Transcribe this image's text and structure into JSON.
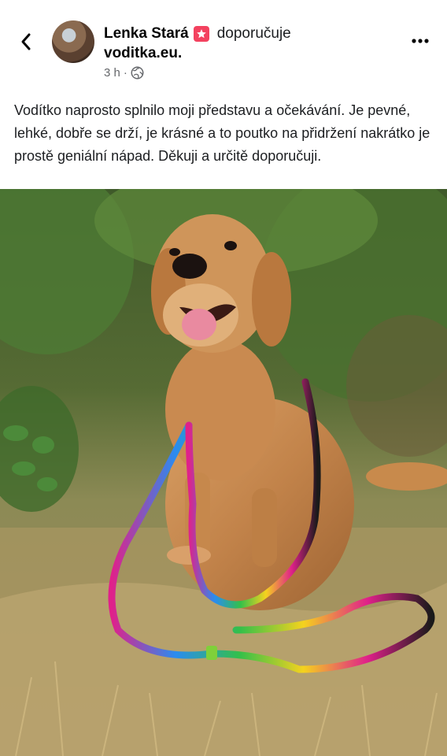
{
  "post": {
    "author": "Lenka Stará",
    "verb": "doporučuje",
    "page": "voditka.eu.",
    "time": "3 h",
    "separator": "·",
    "text": "Vodítko naprosto splnilo moji představu a očekávání. Je pevné, lehké, dobře se drží, je krásné a to poutko na přidržení nakrátko je prostě geniální nápad. Děkuji a určitě doporučuji."
  },
  "icons": {
    "back": "chevron-left-icon",
    "badge": "recommend-star-icon",
    "audience": "globe-icon",
    "more": "more-horizontal-icon"
  },
  "colors": {
    "badge": "#f3425f",
    "secondary_text": "#65676b",
    "primary_text": "#050505"
  }
}
